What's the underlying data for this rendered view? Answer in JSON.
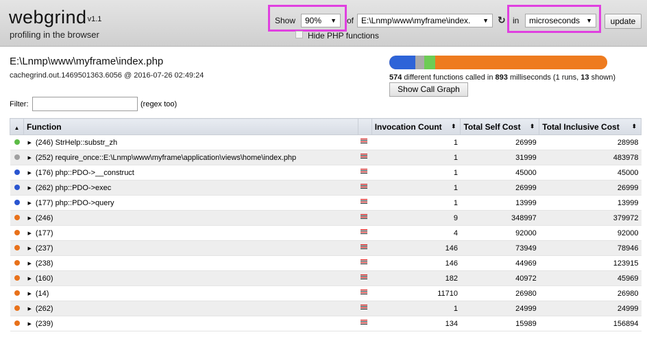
{
  "header": {
    "logo": "webgrind",
    "version": "v1.1",
    "tagline": "profiling in the browser",
    "show_label": "Show",
    "show_value": "90%",
    "of_label": "of",
    "file_value": "E:\\Lnmp\\www\\myframe\\index.",
    "in_label": "in",
    "unit_value": "microseconds",
    "update_label": "update",
    "hide_php_label": "Hide PHP functions"
  },
  "info": {
    "file_title": "E:\\Lnmp\\www\\myframe\\index.php",
    "file_sub": "cachegrind.out.1469501363.6056 @ 2016-07-26 02:49:24",
    "functions_count": "574",
    "functions_text": "different functions called in",
    "milliseconds": "893",
    "ms_text": "milliseconds (1 runs,",
    "shown_count": "13",
    "shown_text": "shown)",
    "call_graph_label": "Show Call Graph",
    "filter_label": "Filter:",
    "filter_value": "",
    "filter_hint": "(regex too)"
  },
  "cost_bar": [
    {
      "color": "#2e64d8",
      "fraction": 0.12
    },
    {
      "color": "#aaaaaa",
      "fraction": 0.04
    },
    {
      "color": "#6dcc55",
      "fraction": 0.05
    },
    {
      "color": "#ee7b1f",
      "fraction": 0.79
    }
  ],
  "colors": {
    "green": "#5cbb46",
    "gray": "#a0a0a0",
    "blue": "#2a55d0",
    "orange": "#e8711a"
  },
  "table": {
    "headers": {
      "function": "Function",
      "invocation": "Invocation Count",
      "self": "Total Self Cost",
      "inclusive": "Total Inclusive Cost"
    },
    "rows": [
      {
        "color": "green",
        "name": "(246) StrHelp::substr_zh",
        "invocation": "1",
        "self": "26999",
        "inclusive": "28998"
      },
      {
        "color": "gray",
        "name": "(252) require_once::E:\\Lnmp\\www\\myframe\\application\\views\\home\\index.php",
        "invocation": "1",
        "self": "31999",
        "inclusive": "483978"
      },
      {
        "color": "blue",
        "name": "(176) php::PDO->__construct",
        "invocation": "1",
        "self": "45000",
        "inclusive": "45000"
      },
      {
        "color": "blue",
        "name": "(262) php::PDO->exec",
        "invocation": "1",
        "self": "26999",
        "inclusive": "26999"
      },
      {
        "color": "blue",
        "name": "(177) php::PDO->query",
        "invocation": "1",
        "self": "13999",
        "inclusive": "13999"
      },
      {
        "color": "orange",
        "name": "(246)",
        "invocation": "9",
        "self": "348997",
        "inclusive": "379972"
      },
      {
        "color": "orange",
        "name": "(177)",
        "invocation": "4",
        "self": "92000",
        "inclusive": "92000"
      },
      {
        "color": "orange",
        "name": "(237)",
        "invocation": "146",
        "self": "73949",
        "inclusive": "78946"
      },
      {
        "color": "orange",
        "name": "(238)",
        "invocation": "146",
        "self": "44969",
        "inclusive": "123915"
      },
      {
        "color": "orange",
        "name": "(160)",
        "invocation": "182",
        "self": "40972",
        "inclusive": "45969"
      },
      {
        "color": "orange",
        "name": "(14)",
        "invocation": "11710",
        "self": "26980",
        "inclusive": "26980"
      },
      {
        "color": "orange",
        "name": "(262)",
        "invocation": "1",
        "self": "24999",
        "inclusive": "24999"
      },
      {
        "color": "orange",
        "name": "(239)",
        "invocation": "134",
        "self": "15989",
        "inclusive": "156894"
      }
    ]
  }
}
